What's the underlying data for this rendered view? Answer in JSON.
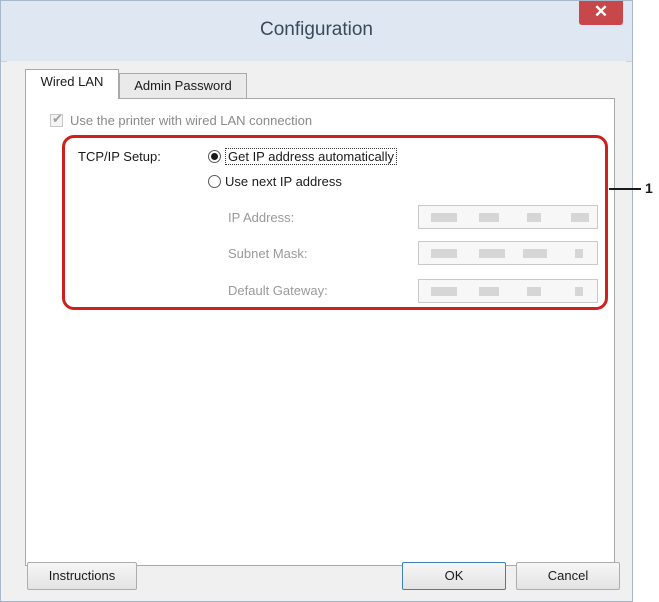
{
  "window": {
    "title": "Configuration",
    "close_glyph": "✕"
  },
  "tabs": [
    {
      "label": "Wired LAN",
      "active": true
    },
    {
      "label": "Admin Password",
      "active": false
    }
  ],
  "wired_lan": {
    "use_wired_label": "Use the printer with wired LAN connection",
    "use_wired_checked": true,
    "use_wired_enabled": false,
    "tcpip_label": "TCP/IP Setup:",
    "radio_options": [
      {
        "label": "Get IP address automatically",
        "selected": true
      },
      {
        "label": "Use next IP address",
        "selected": false
      }
    ],
    "fields": {
      "ip_address_label": "IP Address:",
      "subnet_mask_label": "Subnet Mask:",
      "default_gateway_label": "Default Gateway:"
    }
  },
  "callout": {
    "number": "1",
    "color": "#d0201d"
  },
  "buttons": {
    "instructions": "Instructions",
    "ok": "OK",
    "cancel": "Cancel"
  },
  "icons": {
    "close": "close-icon",
    "checkbox_mark": "checkmark-icon"
  }
}
